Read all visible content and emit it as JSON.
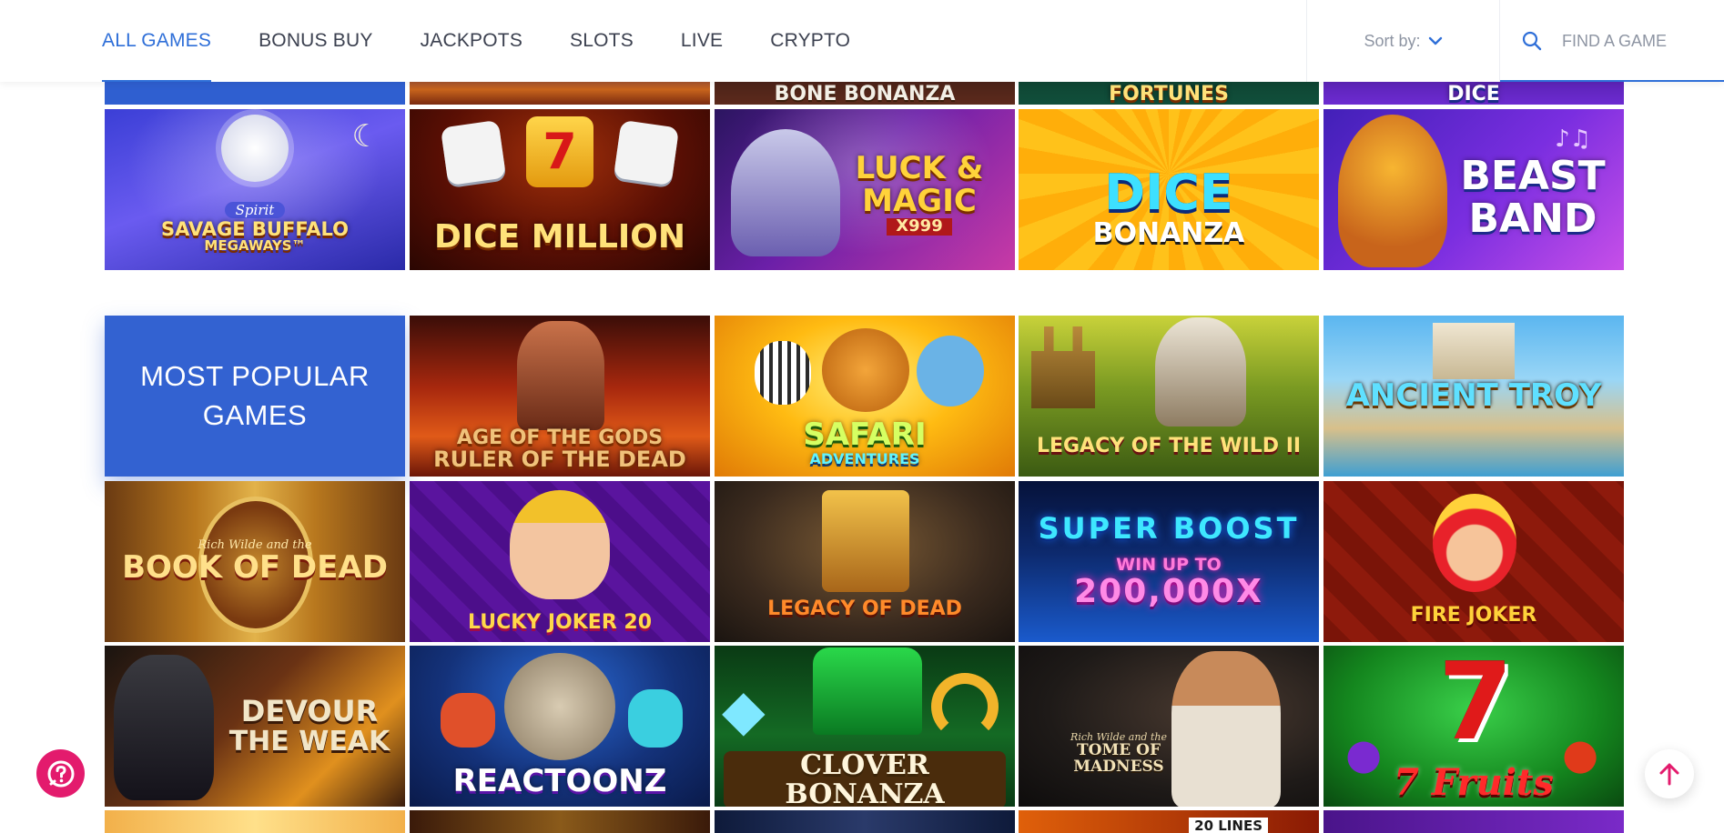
{
  "header": {
    "nav_tabs": [
      {
        "label": "ALL GAMES",
        "active": true
      },
      {
        "label": "BONUS BUY",
        "active": false
      },
      {
        "label": "JACKPOTS",
        "active": false
      },
      {
        "label": "SLOTS",
        "active": false
      },
      {
        "label": "LIVE",
        "active": false
      },
      {
        "label": "CRYPTO",
        "active": false
      }
    ],
    "sort_label": "Sort by:",
    "search_placeholder": "FIND A GAME"
  },
  "colors": {
    "accent": "#2f6fd8",
    "category_tile": "#3362d1",
    "help_button": "#e31b6d",
    "scroll_arrow": "#e31b6d"
  },
  "top_row_partial": [
    {
      "title": ""
    },
    {
      "title": ""
    },
    {
      "title": "BONE BONANZA"
    },
    {
      "title": "FORTUNES"
    },
    {
      "title": "DICE"
    }
  ],
  "row_1": [
    {
      "title": "SAVAGE BUFFALO",
      "subtitle": "MEGAWAYS™",
      "badge": "Spirit"
    },
    {
      "title": "DICE MILLION"
    },
    {
      "title": "LUCK & MAGIC",
      "subtitle": "x999"
    },
    {
      "title": "DICE",
      "subtitle": "BONANZA"
    },
    {
      "title": "BEAST",
      "subtitle": "BAND"
    }
  ],
  "most_popular": {
    "heading": "MOST POPULAR GAMES",
    "row_a": [
      {
        "title": "AGE OF THE GODS",
        "subtitle": "RULER OF THE DEAD"
      },
      {
        "title": "SAFARI",
        "subtitle": "ADVENTURES"
      },
      {
        "title": "LEGACY of the WILD II"
      },
      {
        "title": "ANCIENT TROY"
      }
    ],
    "row_b": [
      {
        "title": "BOOK OF DEAD",
        "badge": "Rich Wilde and the"
      },
      {
        "title": "LUCKY JOKER 20"
      },
      {
        "title": "LEGACY OF DEAD"
      },
      {
        "title": "SUPER BOOST",
        "subtitle": "WIN UP TO",
        "value": "200,000x"
      },
      {
        "title": "FIRE JOKER"
      }
    ],
    "row_c": [
      {
        "title": "DEVOUR",
        "subtitle": "THE WEAK"
      },
      {
        "title": "REACTOONZ"
      },
      {
        "title": "CLOVER BONANZA"
      },
      {
        "title": "TOME OF MADNESS",
        "badge": "Rich Wilde and the"
      },
      {
        "title": "7 Fruits"
      }
    ],
    "bottom_partial": [
      {
        "title": ""
      },
      {
        "title": ""
      },
      {
        "title": ""
      },
      {
        "title": "20 LINES"
      },
      {
        "title": ""
      }
    ]
  }
}
